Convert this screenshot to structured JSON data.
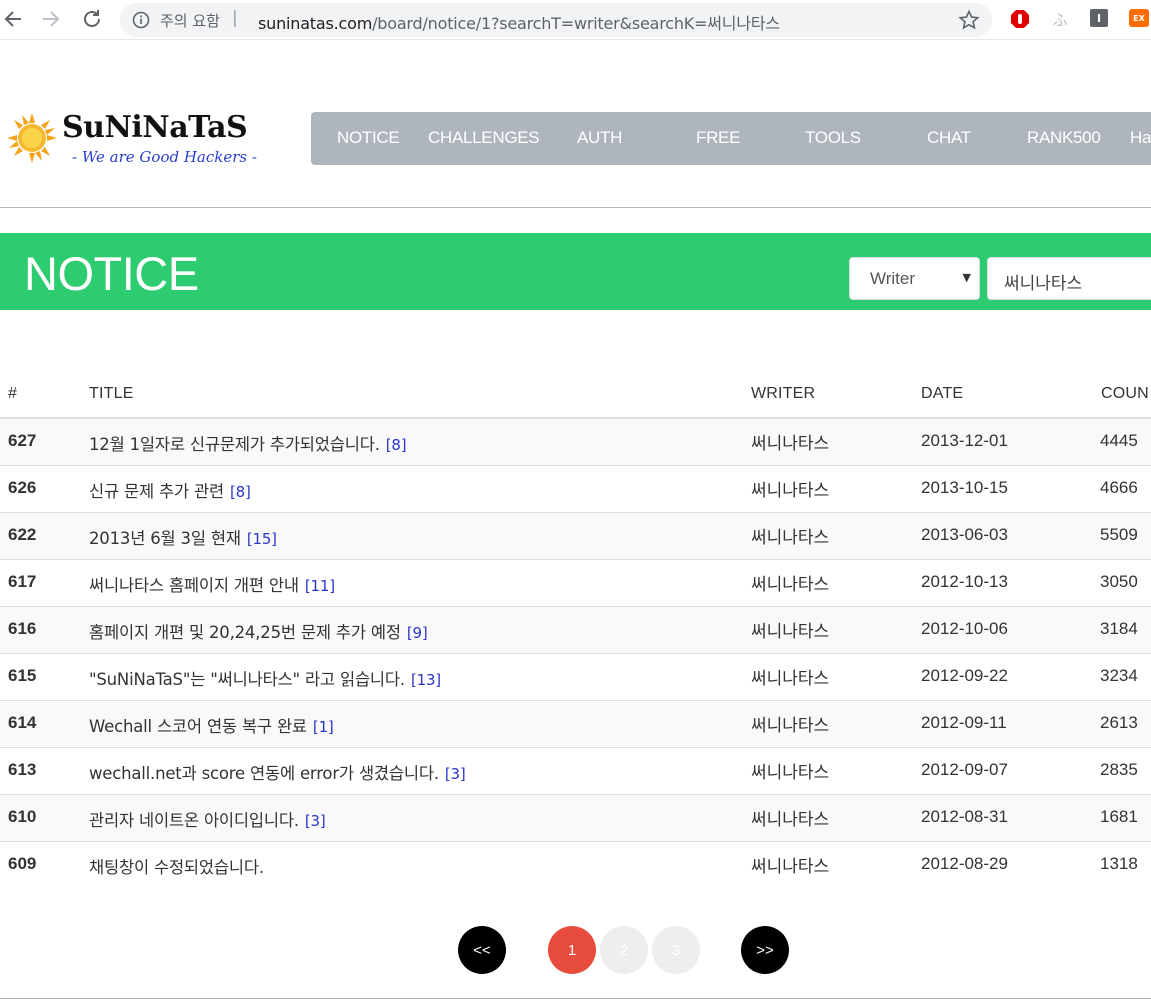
{
  "browser": {
    "security_label": "주의 요함",
    "url_domain": "suninatas.com",
    "url_path": "/board/notice/1?searchT=writer&searchK=써니나타스",
    "ext_i_label": "I",
    "ext_ex_label": "EX",
    "ext_fu_label": "ふ"
  },
  "logo": {
    "brand": "SuNiNaTaS",
    "tagline": "- We are Good Hackers -"
  },
  "nav": {
    "items": [
      "NOTICE",
      "CHALLENGES",
      "AUTH",
      "FREE",
      "TOOLS",
      "CHAT",
      "RANK500",
      "Ha"
    ]
  },
  "banner": {
    "title": "NOTICE",
    "search_type": "Writer",
    "search_keyword": "써니나타스"
  },
  "table": {
    "headers": [
      "#",
      "TITLE",
      "WRITER",
      "DATE",
      "COUN"
    ],
    "rows": [
      {
        "num": "627",
        "title": "12월 1일자로 신규문제가 추가되었습니다.",
        "comments": "[8]",
        "writer": "써니나타스",
        "date": "2013-12-01",
        "count": "4445"
      },
      {
        "num": "626",
        "title": "신규 문제 추가 관련",
        "comments": "[8]",
        "writer": "써니나타스",
        "date": "2013-10-15",
        "count": "4666"
      },
      {
        "num": "622",
        "title": "2013년 6월 3일 현재",
        "comments": "[15]",
        "writer": "써니나타스",
        "date": "2013-06-03",
        "count": "5509"
      },
      {
        "num": "617",
        "title": "써니나타스 홈페이지 개편 안내",
        "comments": "[11]",
        "writer": "써니나타스",
        "date": "2012-10-13",
        "count": "3050"
      },
      {
        "num": "616",
        "title": "홈페이지 개편 및 20,24,25번 문제 추가 예정",
        "comments": "[9]",
        "writer": "써니나타스",
        "date": "2012-10-06",
        "count": "3184"
      },
      {
        "num": "615",
        "title": "\"SuNiNaTaS\"는 \"써니나타스\" 라고 읽습니다.",
        "comments": "[13]",
        "writer": "써니나타스",
        "date": "2012-09-22",
        "count": "3234"
      },
      {
        "num": "614",
        "title": "Wechall 스코어 연동 복구 완료",
        "comments": "[1]",
        "writer": "써니나타스",
        "date": "2012-09-11",
        "count": "2613"
      },
      {
        "num": "613",
        "title": "wechall.net과 score 연동에 error가 생겼습니다.",
        "comments": "[3]",
        "writer": "써니나타스",
        "date": "2012-09-07",
        "count": "2835"
      },
      {
        "num": "610",
        "title": "관리자 네이트온 아이디입니다.",
        "comments": "[3]",
        "writer": "써니나타스",
        "date": "2012-08-31",
        "count": "1681"
      },
      {
        "num": "609",
        "title": "채팅창이 수정되었습니다.",
        "comments": "",
        "writer": "써니나타스",
        "date": "2012-08-29",
        "count": "1318"
      }
    ]
  },
  "pagination": {
    "prev_label": "<<",
    "next_label": ">>",
    "pages": [
      "1",
      "2",
      "3"
    ],
    "current": "1"
  },
  "colors": {
    "banner_green": "#2ecc71",
    "nav_gray": "#aeb5bd",
    "active_page_red": "#e74c3c",
    "comment_link_blue": "#2a36c8"
  }
}
